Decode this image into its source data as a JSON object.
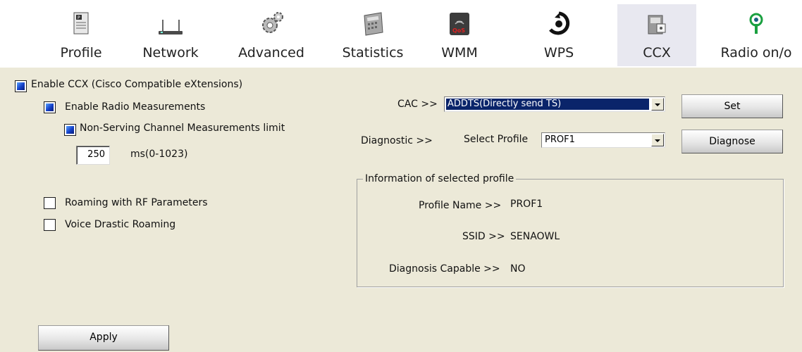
{
  "toolbar": {
    "items": [
      {
        "label": "Profile",
        "icon": "profile-icon"
      },
      {
        "label": "Network",
        "icon": "network-icon"
      },
      {
        "label": "Advanced",
        "icon": "advanced-icon"
      },
      {
        "label": "Statistics",
        "icon": "statistics-icon"
      },
      {
        "label": "WMM",
        "icon": "wmm-icon",
        "icon_text": "QoS"
      },
      {
        "label": "WPS",
        "icon": "wps-icon"
      },
      {
        "label": "CCX",
        "icon": "ccx-icon",
        "selected": true
      },
      {
        "label": "Radio on/o",
        "icon": "radio-icon"
      }
    ]
  },
  "ccx": {
    "enable_ccx_label": "Enable CCX (Cisco Compatible eXtensions)",
    "enable_ccx_checked": true,
    "radio_measurements_label": "Enable Radio Measurements",
    "radio_measurements_checked": true,
    "non_serving_label": "Non-Serving Channel Measurements limit",
    "non_serving_checked": true,
    "limit_value": "250",
    "limit_unit": "ms(0-1023)",
    "roaming_rf_label": "Roaming with RF Parameters",
    "roaming_rf_checked": false,
    "voice_roaming_label": "Voice Drastic Roaming",
    "voice_roaming_checked": false,
    "apply_label": "Apply"
  },
  "cac": {
    "label": "CAC >>",
    "selected": "ADDTS(Directly send TS)",
    "set_label": "Set"
  },
  "diagnostic": {
    "label": "Diagnostic >>",
    "select_profile_label": "Select Profile",
    "selected_profile": "PROF1",
    "diagnose_label": "Diagnose"
  },
  "info": {
    "legend": "Information of selected profile",
    "profile_name_label": "Profile Name >>",
    "profile_name_value": "PROF1",
    "ssid_label": "SSID >>",
    "ssid_value": "SENAOWL",
    "diag_capable_label": "Diagnosis Capable >>",
    "diag_capable_value": "NO"
  },
  "colors": {
    "panel_bg": "#ece9d8",
    "selection": "#0a246a",
    "checkbox_fill": "#1340c8"
  }
}
